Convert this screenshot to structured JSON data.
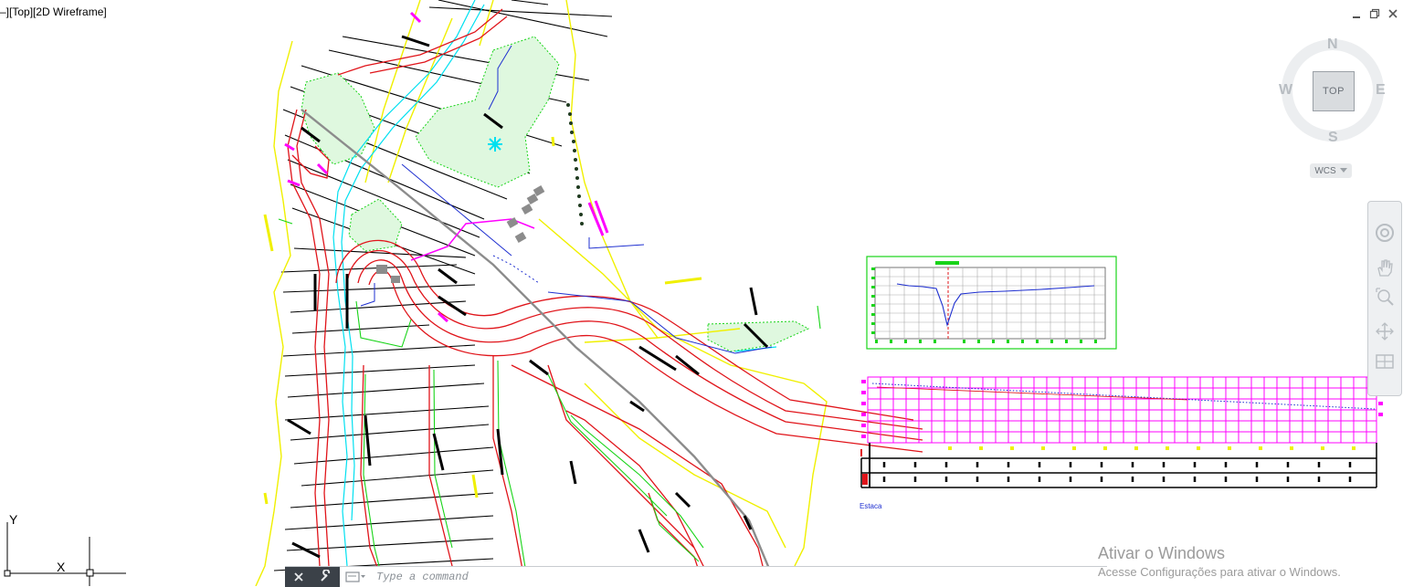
{
  "viewport": {
    "label": "–][Top][2D Wireframe]"
  },
  "window_controls": {
    "minimize_icon": "minimize-icon",
    "restore_icon": "restore-icon",
    "close_icon": "close-icon"
  },
  "viewcube": {
    "top_face": "TOP",
    "north": "N",
    "south": "S",
    "east": "E",
    "west": "W",
    "wcs": "WCS"
  },
  "navigation_bar": {
    "tools": [
      "steering-wheel-icon",
      "pan-icon",
      "zoom-extents-icon",
      "orbit-icon",
      "showmotion-icon"
    ]
  },
  "ucs_icon": {
    "x_label": "X",
    "y_label": "Y"
  },
  "command_line": {
    "placeholder": "Type a command"
  },
  "drawing": {
    "station_label": "Estaca"
  },
  "activation_watermark": {
    "title": "Ativar o Windows",
    "subtitle": "Acesse Configurações para ativar o Windows."
  },
  "colors": {
    "background": "#ffffff",
    "road_red": "#e0141a",
    "green_lines": "#19d419",
    "yellow_lines": "#f0f000",
    "cyan_lines": "#00e0f0",
    "magenta": "#ff00ff",
    "blue": "#1e2fd0",
    "black": "#000000",
    "grey": "#8c8c8c"
  }
}
